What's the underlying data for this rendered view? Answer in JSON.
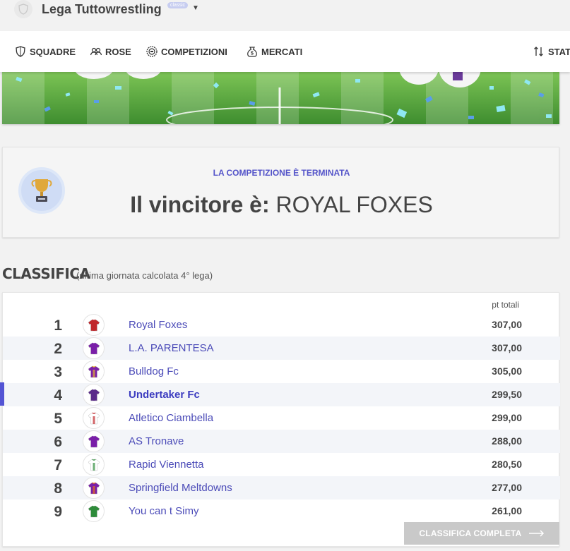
{
  "league": {
    "name": "Lega Tuttowrestling",
    "badge": "classic",
    "logo_icon": "shield-icon"
  },
  "nav": {
    "items": [
      {
        "label": "SQUADRE",
        "icon": "shield-icon"
      },
      {
        "label": "ROSE",
        "icon": "users-icon"
      },
      {
        "label": "COMPETIZIONI",
        "icon": "trophy-badge-icon"
      },
      {
        "label": "MERCATI",
        "icon": "money-bag-icon"
      },
      {
        "label": "STAT",
        "icon": "sort-icon"
      }
    ]
  },
  "winner": {
    "status": "LA COMPETIZIONE È TERMINATA",
    "prefix": "Il vincitore è:",
    "team": "ROYAL FOXES",
    "icon": "trophy-icon"
  },
  "classifica": {
    "title": "CLASSIFICA",
    "subtitle": "(ultima giornata calcolata 4° lega)",
    "column_header": "pt totali",
    "rows": [
      {
        "rank": "1",
        "team": "Royal Foxes",
        "points": "307,00",
        "jersey_color": "#c0262b",
        "jersey_accent": "#c0262b",
        "highlight": false
      },
      {
        "rank": "2",
        "team": "L.A. PARENTESA",
        "points": "307,00",
        "jersey_color": "#7a1fa8",
        "jersey_accent": "#7a1fa8",
        "highlight": false
      },
      {
        "rank": "3",
        "team": "Bulldog Fc",
        "points": "305,00",
        "jersey_color": "#7a1fa8",
        "jersey_accent": "#e6b52c",
        "highlight": false
      },
      {
        "rank": "4",
        "team": "Undertaker Fc",
        "points": "299,50",
        "jersey_color": "#5a2a8a",
        "jersey_accent": "#5a2a8a",
        "highlight": true
      },
      {
        "rank": "5",
        "team": "Atletico Ciambella",
        "points": "299,00",
        "jersey_color": "#ffffff",
        "jersey_accent": "#c0262b",
        "highlight": false
      },
      {
        "rank": "6",
        "team": "AS Tronave",
        "points": "288,00",
        "jersey_color": "#7a1fa8",
        "jersey_accent": "#7a1fa8",
        "highlight": false
      },
      {
        "rank": "7",
        "team": "Rapid Viennetta",
        "points": "280,50",
        "jersey_color": "#ffffff",
        "jersey_accent": "#2e8b3a",
        "highlight": false
      },
      {
        "rank": "8",
        "team": "Springfield Meltdowns",
        "points": "277,00",
        "jersey_color": "#7a1fa8",
        "jersey_accent": "#e8741a",
        "highlight": false
      },
      {
        "rank": "9",
        "team": "You can t Simy",
        "points": "261,00",
        "jersey_color": "#2e8b3a",
        "jersey_accent": "#2e8b3a",
        "highlight": false
      }
    ],
    "full_button": "CLASSIFICA COMPLETA"
  }
}
